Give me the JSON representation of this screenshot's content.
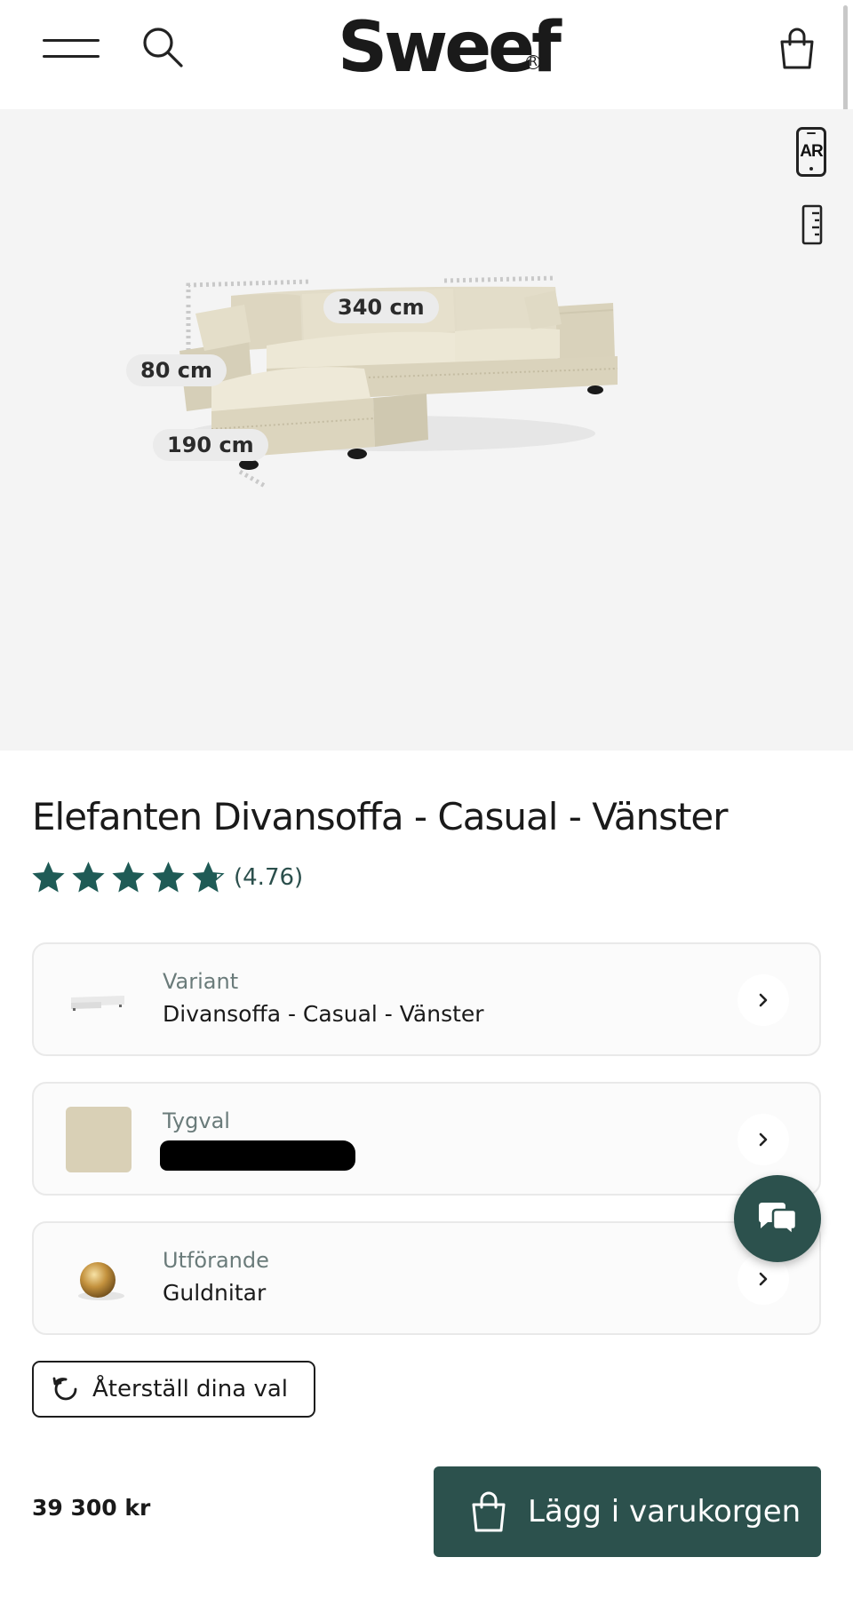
{
  "header": {
    "logo_text": "Sweef",
    "logo_mark": "R",
    "icons": {
      "menu": "hamburger-menu-icon",
      "search": "search-icon",
      "cart": "shopping-bag-icon"
    }
  },
  "viewer": {
    "ar_label": "AR",
    "dimensions": {
      "width": "340 cm",
      "height": "80 cm",
      "depth": "190 cm"
    },
    "background_color": "#f4f4f4"
  },
  "product": {
    "title": "Elefanten Divansoffa - Casual - Vänster",
    "rating_stars": 4.76,
    "rating_text": "(4.76)",
    "star_color": "#1f5b56"
  },
  "options": [
    {
      "label": "Variant",
      "value": "Divansoffa - Casual - Vänster"
    },
    {
      "label": "Tygval",
      "value": ""
    },
    {
      "label": "Utförande",
      "value": "Guldnitar"
    }
  ],
  "actions": {
    "reset_label": "Återställ dina val",
    "price": "39 300 kr",
    "add_to_cart_label": "Lägg i varukorgen"
  },
  "colors": {
    "accent": "#2c514d",
    "text": "#1a1a1a",
    "muted": "#6a7b7a"
  }
}
